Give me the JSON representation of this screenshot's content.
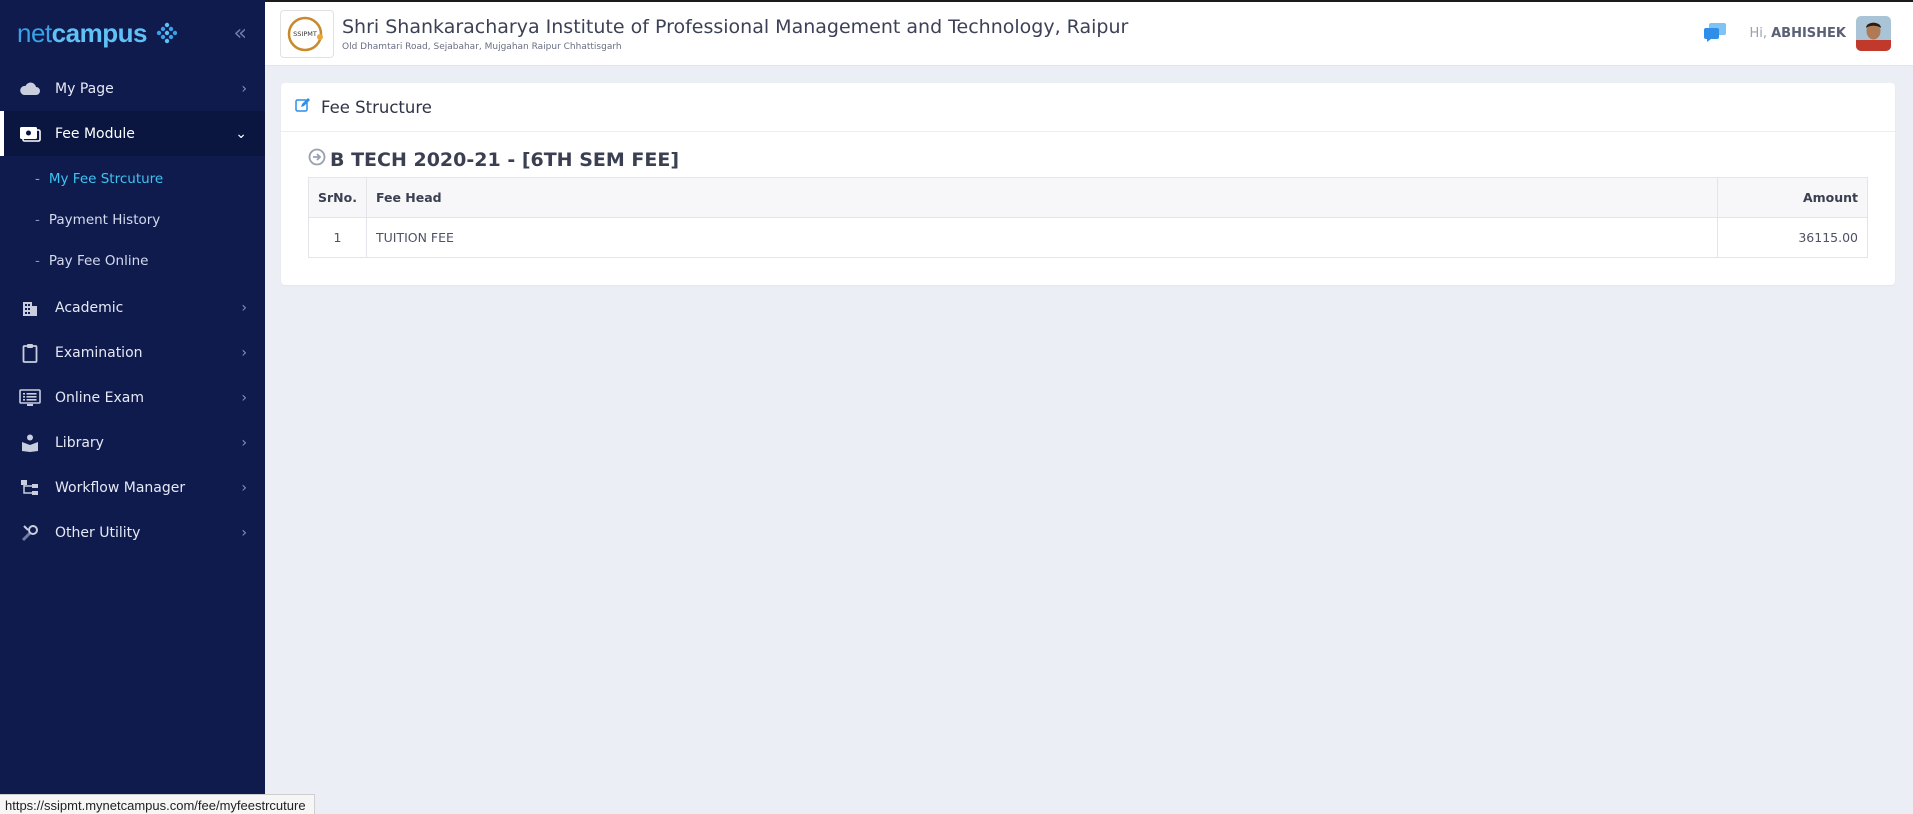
{
  "brand": {
    "net": "net",
    "campus": "campus"
  },
  "sidebar": {
    "items": [
      {
        "label": "My Page",
        "icon": "cloud-icon"
      },
      {
        "label": "Fee Module",
        "icon": "money-icon",
        "active": true,
        "sub": [
          {
            "label": "My Fee Strcuture",
            "current": true
          },
          {
            "label": "Payment History"
          },
          {
            "label": "Pay Fee Online"
          }
        ]
      },
      {
        "label": "Academic",
        "icon": "building-icon"
      },
      {
        "label": "Examination",
        "icon": "clipboard-icon"
      },
      {
        "label": "Online Exam",
        "icon": "monitor-list-icon"
      },
      {
        "label": "Library",
        "icon": "book-reader-icon"
      },
      {
        "label": "Workflow Manager",
        "icon": "workflow-icon"
      },
      {
        "label": "Other Utility",
        "icon": "tools-icon"
      }
    ],
    "sub_dash": "-"
  },
  "header": {
    "institute_name": "Shri Shankaracharya Institute of Professional Management and Technology, Raipur",
    "institute_address": "Old Dhamtari Road, Sejabahar, Mujgahan Raipur Chhattisgarh",
    "greeting": "Hi,",
    "user": "ABHISHEK",
    "logo_text": "SSIPMT"
  },
  "card": {
    "title": "Fee Structure",
    "section_title": "B TECH 2020-21 - [6TH SEM FEE]",
    "columns": [
      "SrNo.",
      "Fee Head",
      "Amount"
    ],
    "rows": [
      {
        "sr": "1",
        "head": "TUITION FEE",
        "amount": "36115.00"
      }
    ]
  },
  "status_url": "https://ssipmt.mynetcampus.com/fee/myfeestrcuture",
  "colors": {
    "sidebar": "#0f1b4d",
    "accent": "#3ec4f2",
    "background": "#eceef6"
  }
}
